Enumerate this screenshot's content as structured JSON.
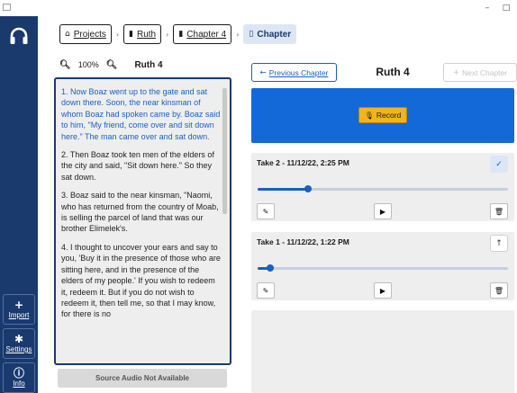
{
  "window": {
    "minimize": "–",
    "maximize": "□"
  },
  "sidebar": {
    "import_label": "Import",
    "settings_label": "Settings",
    "info_label": "Info"
  },
  "breadcrumb": {
    "projects": "Projects",
    "book": "Ruth",
    "chapter": "Chapter 4",
    "current": "Chapter"
  },
  "zoom": {
    "level": "100%",
    "book_chapter": "Ruth 4"
  },
  "verses": [
    "1. Now Boaz went up to the gate and sat down there. Soon, the near kinsman of whom Boaz had spoken came by. Boaz said to him, \"My friend, come over and sit down here.\" The man came over and sat down.",
    "2. Then Boaz took ten men of the elders of the city and said, \"Sit down here.\" So they sat down.",
    "3. Boaz said to the near kinsman, \"Naomi, who has returned from the country of Moab, is selling the parcel of land that was our brother Elimelek's.",
    "4. I thought to uncover your ears and say to you, 'Buy it in the presence of those who are sitting here, and in the presence of the elders of my people.' If you wish to redeem it, redeem it. But if you do not wish to redeem it, then tell me, so that I may know, for there is no"
  ],
  "source_audio": "Source Audio Not Available",
  "nav": {
    "prev": "Previous Chapter",
    "title": "Ruth 4",
    "next": "Next Chapter"
  },
  "record_label": "Record",
  "takes": [
    {
      "title": "Take 2 - 11/12/22, 2:25 PM",
      "progress": 0.2,
      "status": "selected"
    },
    {
      "title": "Take 1 - 11/12/22, 1:22 PM",
      "progress": 0.05,
      "status": "promote"
    }
  ]
}
